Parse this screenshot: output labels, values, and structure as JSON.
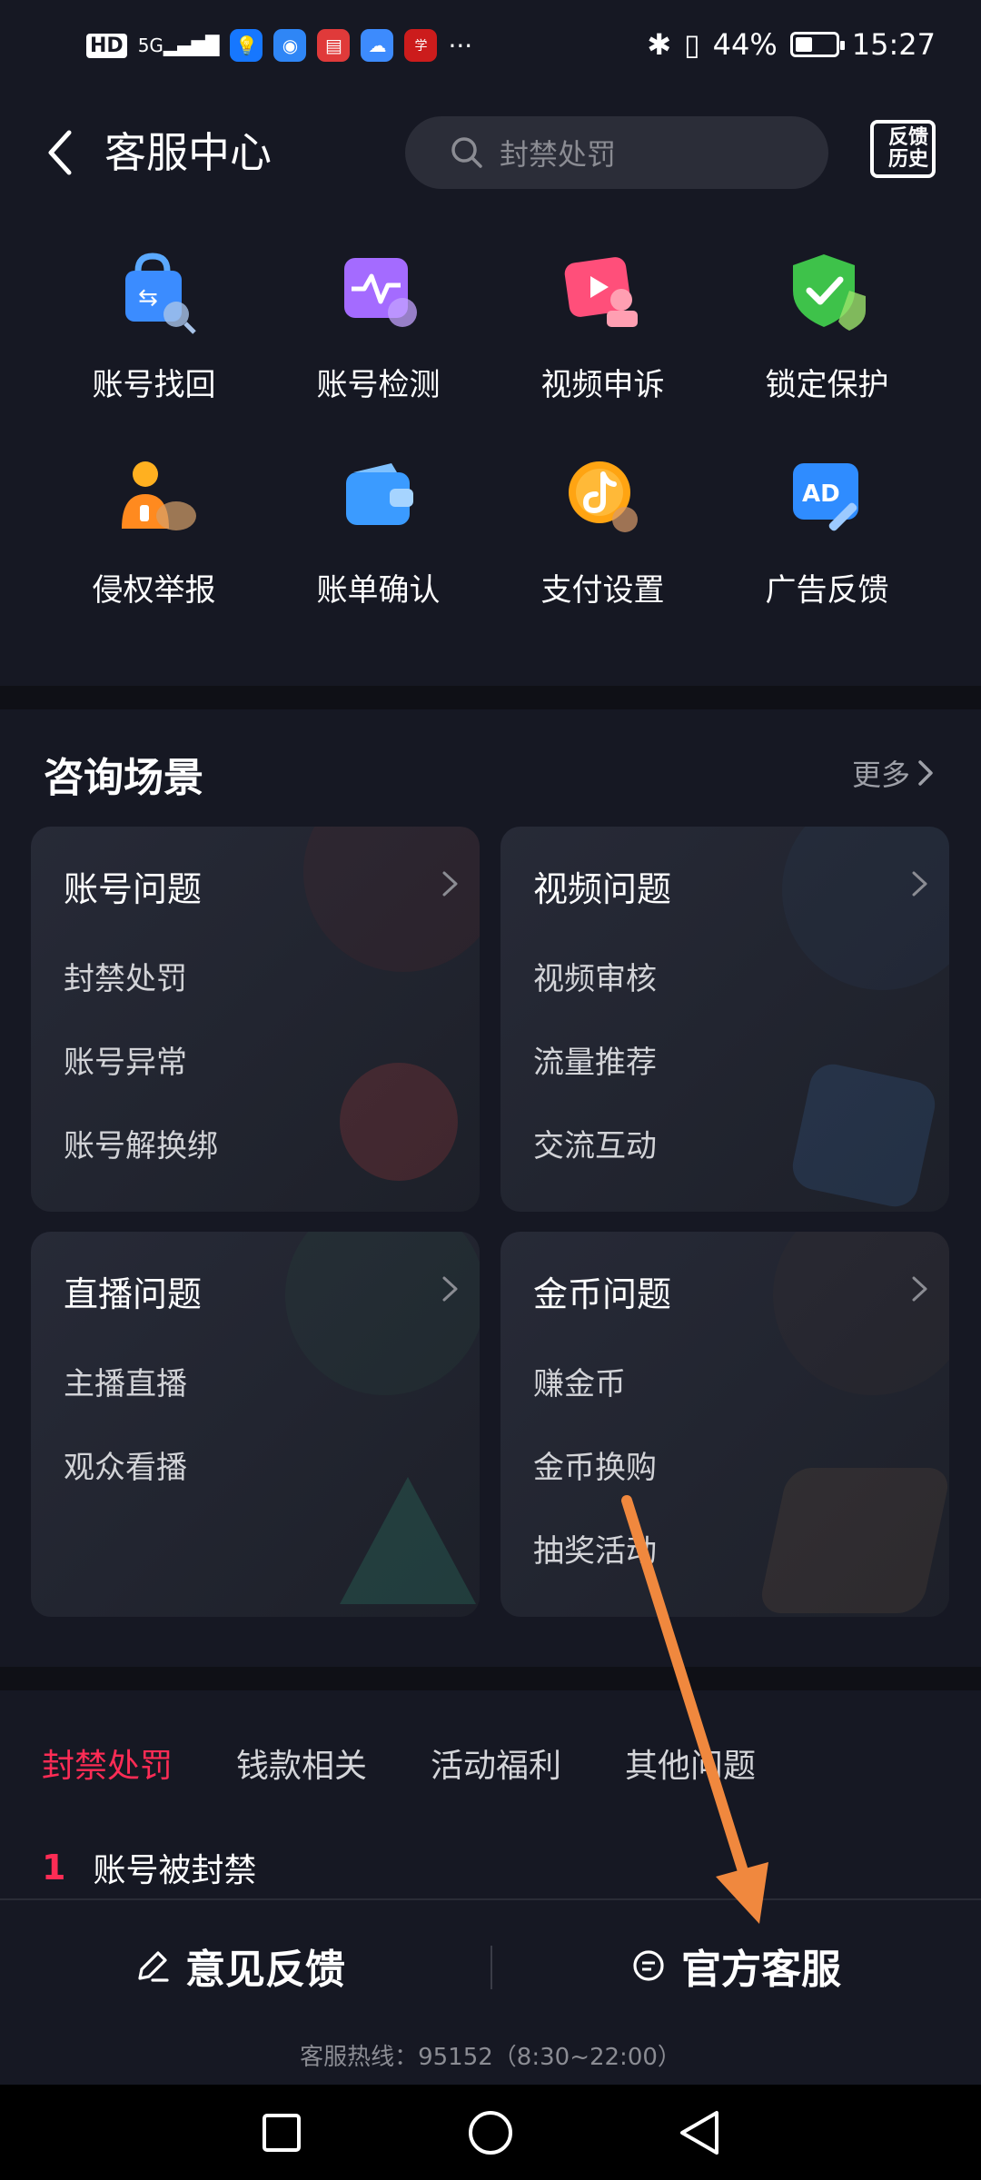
{
  "status_bar": {
    "left": [
      "HD",
      "5G",
      "...",
      "···"
    ],
    "battery_percent": "44%",
    "battery_level": 0.44,
    "time": "15:27"
  },
  "header": {
    "title": "客服中心",
    "search_placeholder": "封禁处罚",
    "feedback_history_label": "反馈历史"
  },
  "services": [
    {
      "label": "账号找回",
      "icon": "account-recovery-icon"
    },
    {
      "label": "账号检测",
      "icon": "account-check-icon"
    },
    {
      "label": "视频申诉",
      "icon": "video-appeal-icon"
    },
    {
      "label": "锁定保护",
      "icon": "lock-protect-icon"
    },
    {
      "label": "侵权举报",
      "icon": "infringement-report-icon"
    },
    {
      "label": "账单确认",
      "icon": "bill-confirm-icon"
    },
    {
      "label": "支付设置",
      "icon": "payment-settings-icon"
    },
    {
      "label": "广告反馈",
      "icon": "ad-feedback-icon"
    }
  ],
  "consult": {
    "title": "咨询场景",
    "more": "更多",
    "cards": [
      {
        "title": "账号问题",
        "items": [
          "封禁处罚",
          "账号异常",
          "账号解换绑"
        ]
      },
      {
        "title": "视频问题",
        "items": [
          "视频审核",
          "流量推荐",
          "交流互动"
        ]
      },
      {
        "title": "直播问题",
        "items": [
          "主播直播",
          "观众看播"
        ]
      },
      {
        "title": "金币问题",
        "items": [
          "赚金币",
          "金币换购",
          "抽奖活动"
        ]
      }
    ]
  },
  "tabs": [
    "封禁处罚",
    "钱款相关",
    "活动福利",
    "其他问题"
  ],
  "questions": [
    {
      "rank": "1",
      "text": "账号被封禁"
    }
  ],
  "bottom": {
    "feedback_label": "意见反馈",
    "official_label": "官方客服",
    "hotline": "客服热线：95152（8:30~22:00）"
  },
  "colors": {
    "background": "#161823",
    "accent": "#fe2c55",
    "annotation_arrow": "#f0883e"
  }
}
